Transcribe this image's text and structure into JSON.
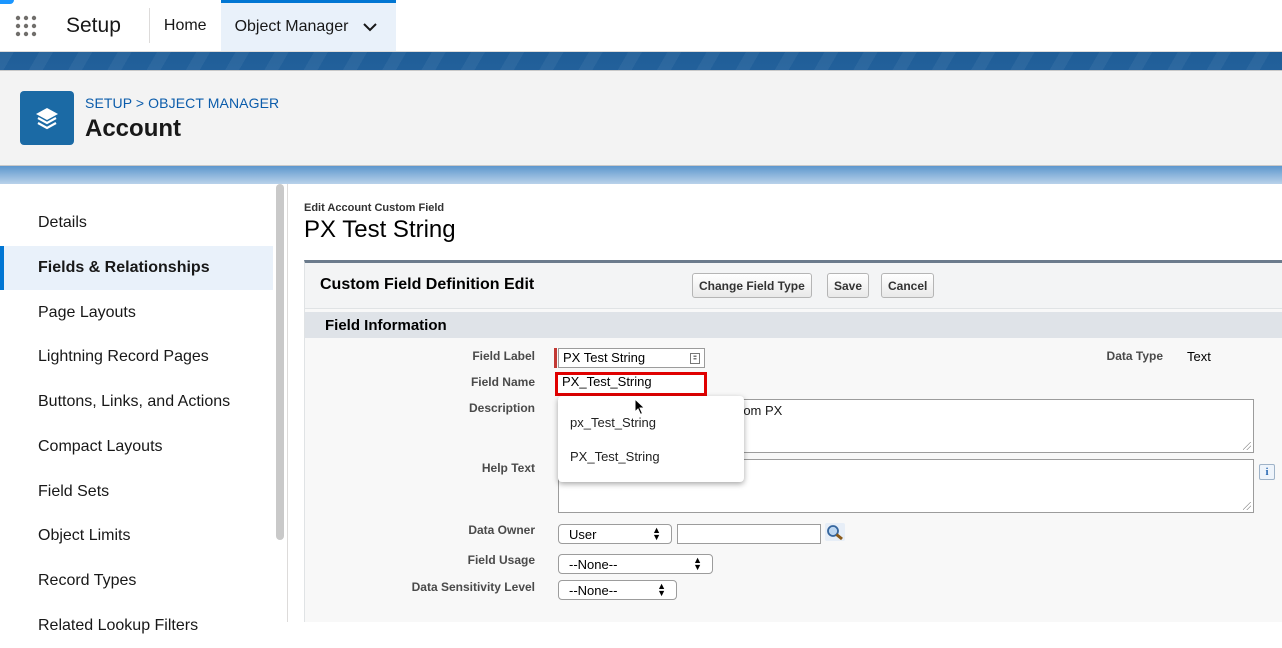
{
  "topnav": {
    "app_name": "Setup",
    "tabs": [
      {
        "label": "Home"
      },
      {
        "label": "Object Manager"
      }
    ]
  },
  "header": {
    "breadcrumb": "SETUP > OBJECT MANAGER",
    "title": "Account",
    "icon": "layers-icon"
  },
  "sidebar": {
    "items": [
      {
        "label": "Details"
      },
      {
        "label": "Fields & Relationships"
      },
      {
        "label": "Page Layouts"
      },
      {
        "label": "Lightning Record Pages"
      },
      {
        "label": "Buttons, Links, and Actions"
      },
      {
        "label": "Compact Layouts"
      },
      {
        "label": "Field Sets"
      },
      {
        "label": "Object Limits"
      },
      {
        "label": "Record Types"
      },
      {
        "label": "Related Lookup Filters"
      }
    ],
    "active_index": 1
  },
  "main": {
    "subtitle": "Edit Account Custom Field",
    "title": "PX Test String",
    "panel_title": "Custom Field Definition Edit",
    "buttons": {
      "change_field_type": "Change Field Type",
      "save": "Save",
      "cancel": "Cancel"
    },
    "section_title": "Field Information",
    "labels": {
      "field_label": "Field Label",
      "field_name": "Field Name",
      "description": "Description",
      "help_text": "Help Text",
      "data_owner": "Data Owner",
      "field_usage": "Field Usage",
      "data_sensitivity": "Data Sensitivity Level",
      "data_type": "Data Type"
    },
    "values": {
      "field_label": "PX Test String",
      "field_name": "PX_Test_String",
      "description_visible": "rom PX",
      "data_type": "Text",
      "data_owner": "User",
      "field_usage": "--None--",
      "data_sensitivity": "--None--"
    },
    "autocomplete": [
      "px_Test_String",
      "PX_Test_String"
    ]
  }
}
